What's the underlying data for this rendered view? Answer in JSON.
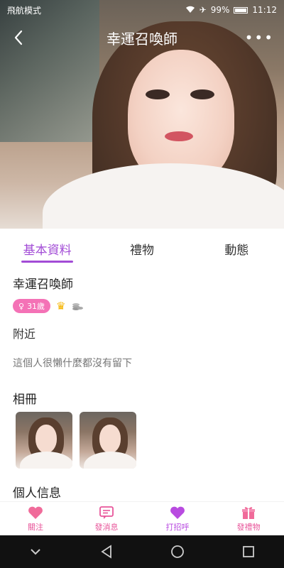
{
  "status": {
    "left": "飛航模式",
    "battery": "99%",
    "time": "11:12"
  },
  "header": {
    "title": "幸運召喚師"
  },
  "tabs": [
    {
      "label": "基本資料",
      "active": true
    },
    {
      "label": "禮物",
      "active": false
    },
    {
      "label": "動態",
      "active": false
    }
  ],
  "profile": {
    "name": "幸運召喚師",
    "age_badge": "31歲",
    "location": "附近",
    "signature": "這個人很懶什麼都沒有留下"
  },
  "album": {
    "title": "相冊",
    "photos": 2
  },
  "personal_info": {
    "title": "個人信息"
  },
  "actions": [
    {
      "label": "關注",
      "icon": "heart-icon"
    },
    {
      "label": "發消息",
      "icon": "message-icon"
    },
    {
      "label": "打招呼",
      "icon": "heart-icon"
    },
    {
      "label": "發禮物",
      "icon": "gift-icon"
    }
  ],
  "colors": {
    "accent": "#a24bd6",
    "pink": "#e8559a",
    "badge": "#f472b6"
  }
}
